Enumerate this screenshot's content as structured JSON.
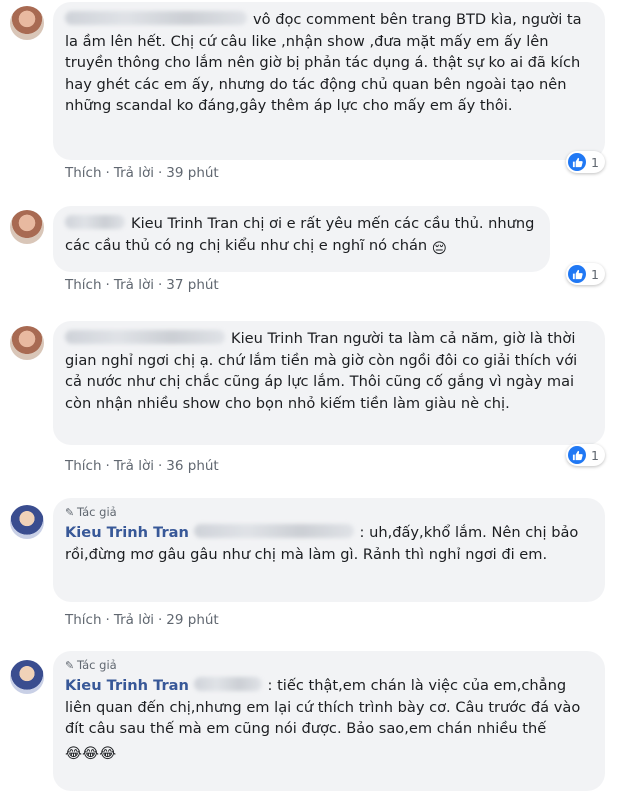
{
  "comments": [
    {
      "text": "vô đọc comment bên trang BTD kìa, người ta la ầm lên hết. Chị cứ câu like ,nhận show ,đưa mặt mấy em ấy lên truyền thông cho lắm nên giờ bị phản tác dụng á. thật sự ko ai đã kích hay ghét các em ấy, nhưng do tác động chủ quan bên ngoài tạo nên những scandal ko đáng,gây thêm áp lực cho mấy em ấy thôi.",
      "like_label": "Thích",
      "reply_label": "Trả lời",
      "time": "39 phút",
      "reaction_count": "1"
    },
    {
      "mention": "Kieu Trinh Tran",
      "text": "chị ơi e rất yêu mến các cầu thủ. nhưng các cầu thủ có ng chị kiểu như chị e nghĩ nó chán",
      "like_label": "Thích",
      "reply_label": "Trả lời",
      "time": "37 phút",
      "reaction_count": "1"
    },
    {
      "mention": "Kieu Trinh Tran",
      "text": "người ta làm cả năm, giờ là thời gian nghỉ ngơi chị ạ. chứ lắm tiền mà giờ còn ngồi đôi co giải thích với cả nước như chị chắc cũng áp lực lắm. Thôi cũng cố gắng vì ngày mai còn nhận nhiều show cho bọn nhỏ kiếm tiền làm giàu nè chị.",
      "like_label": "Thích",
      "reply_label": "Trả lời",
      "time": "36 phút",
      "reaction_count": "1"
    },
    {
      "author_tag": "Tác giả",
      "author": "Kieu Trinh Tran",
      "text": ": uh,đấy,khổ lắm. Nên chị bảo rồi,đừng mơ gâu gâu như chị mà làm gì. Rảnh thì nghỉ ngơi đi em.",
      "like_label": "Thích",
      "reply_label": "Trả lời",
      "time": "29 phút"
    },
    {
      "author_tag": "Tác giả",
      "author": "Kieu Trinh Tran",
      "text": ": tiếc thật,em chán là việc của em,chẳng liên quan đến chị,nhưng em lại cứ thích trình bày cơ. Câu trước đá vào đít câu sau thế mà em cũng nói được. Bảo sao,em chán nhiều thế",
      "emojis": "😂😂😂"
    }
  ],
  "emoji_face": "😔",
  "icons": {
    "like": "thumbs-up-icon",
    "author_badge": "pencil-icon"
  },
  "colors": {
    "like_blue": "#2078f4",
    "bubble": "#f2f3f5",
    "author_name": "#385898",
    "meta": "#606770"
  }
}
